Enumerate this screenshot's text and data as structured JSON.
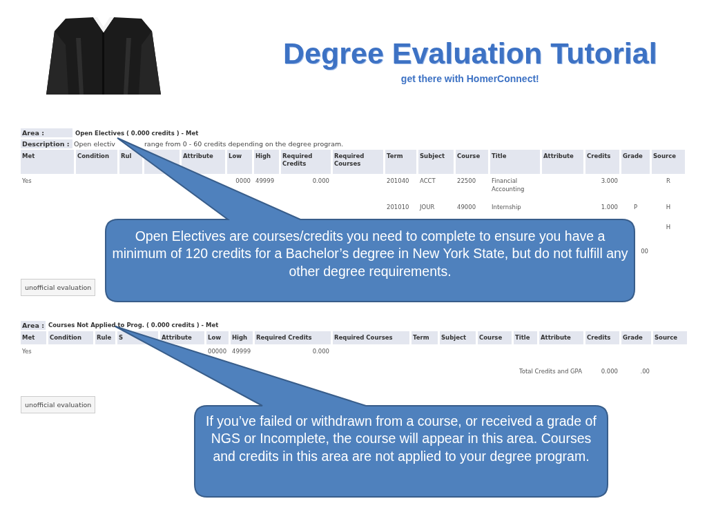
{
  "header": {
    "title": "Degree Evaluation Tutorial",
    "subtitle": "get there with HomerConnect!"
  },
  "sections": [
    {
      "area_label": "Area :",
      "area_value": "Open Electives ( 0.000 credits ) - Met",
      "description_label": "Description :",
      "description": "Open electiv",
      "description_2": "range from 0 - 60 credits depending on the degree program.",
      "columns": [
        "Met",
        "Condition",
        "Rul",
        null,
        "Attribute",
        "Low",
        "High",
        "Required Credits",
        "Required Courses",
        "Term",
        "Subject",
        "Course",
        "Title",
        "Attribute",
        "Credits",
        "Grade",
        "Source"
      ],
      "rows": [
        [
          "Yes",
          null,
          null,
          null,
          null,
          "0000",
          "49999",
          "0.000",
          null,
          "201040",
          "ACCT",
          "22500",
          "Financial Accounting",
          null,
          "3.000",
          null,
          "R"
        ],
        [
          null,
          null,
          null,
          null,
          null,
          null,
          null,
          null,
          null,
          "201010",
          "JOUR",
          "49000",
          "Internship",
          null,
          "1.000",
          "P",
          "H"
        ],
        [
          null,
          null,
          null,
          null,
          null,
          null,
          null,
          null,
          null,
          null,
          null,
          null,
          null,
          null,
          null,
          null,
          "H"
        ]
      ],
      "totals": {
        "gpa": "00"
      },
      "button": "unofficial evaluation",
      "callout": "Open Electives are courses/credits you need to complete to ensure you have a minimum of 120 credits for a Bachelor’s degree in New York State, but do not fulfill any other degree requirements."
    },
    {
      "area_label": "Area :",
      "area_value": "Courses Not Applied to Prog. ( 0.000 credits ) - Met",
      "columns": [
        "Met",
        "Condition",
        "Rule",
        "S",
        "Attribute",
        "Low",
        "High",
        "Required Credits",
        "Required Courses",
        "Term",
        "Subject",
        "Course",
        "Title",
        "Attribute",
        "Credits",
        "Grade",
        "Source"
      ],
      "rows": [
        [
          "Yes",
          null,
          null,
          null,
          null,
          "00000",
          "49999",
          "0.000",
          null,
          null,
          null,
          null,
          null,
          null,
          null,
          null,
          null
        ]
      ],
      "totals": {
        "label": "Total Credits and GPA",
        "credits": "0.000",
        "gpa": ".00"
      },
      "button": "unofficial evaluation",
      "callout": "If you’ve failed or withdrawn from a course, or received a grade of NGS or Incomplete, the course will appear in this area.  Courses and credits in this area are not applied to your degree program."
    }
  ]
}
